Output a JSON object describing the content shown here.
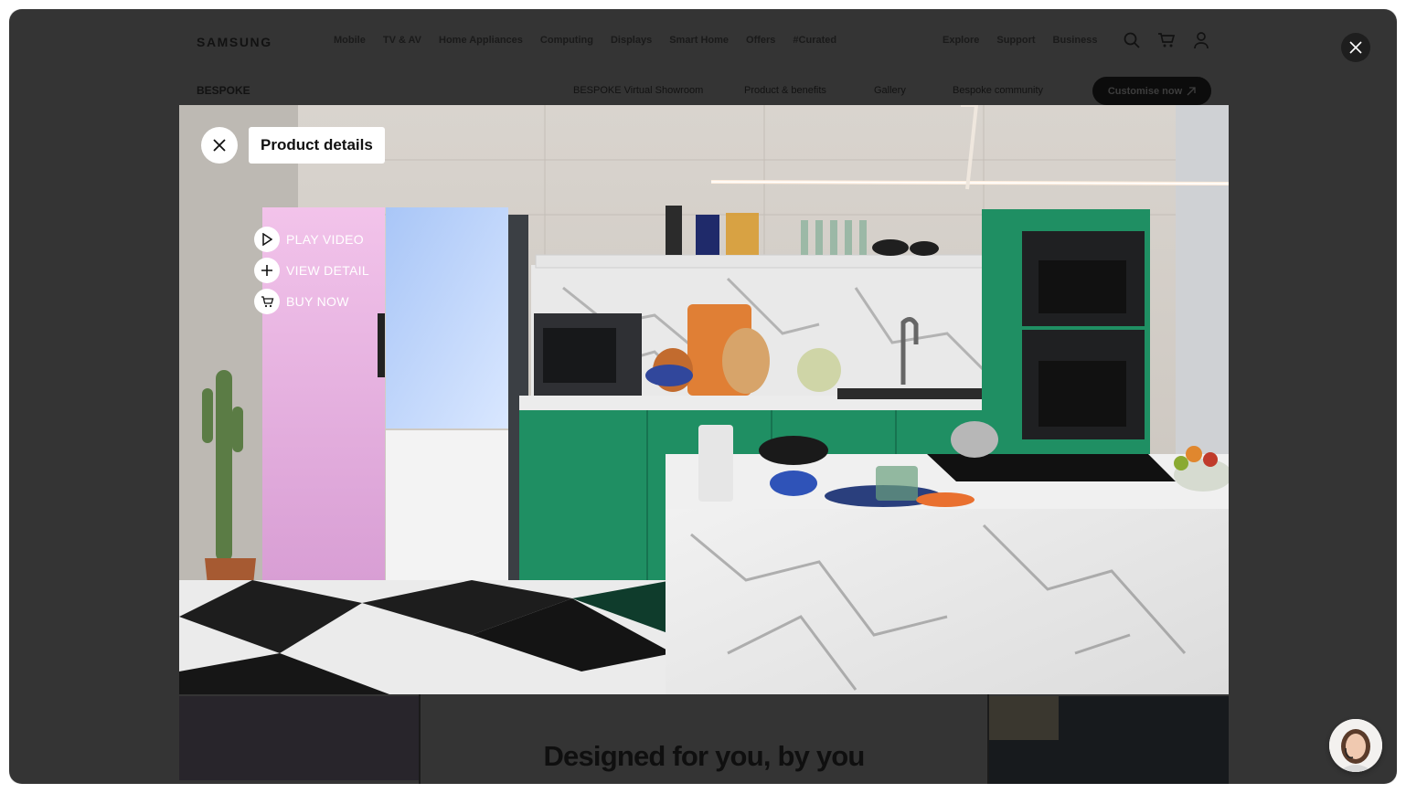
{
  "header": {
    "logo": "SAMSUNG",
    "nav": [
      "Mobile",
      "TV & AV",
      "Home Appliances",
      "Computing",
      "Displays",
      "Smart Home",
      "Offers",
      "#Curated"
    ],
    "util": [
      "Explore",
      "Support",
      "Business"
    ],
    "icons": [
      "search-icon",
      "cart-icon",
      "user-icon"
    ]
  },
  "subnav": {
    "brand": "BESPOKE",
    "links": [
      "BESPOKE Virtual Showroom",
      "Product & benefits",
      "Gallery",
      "Bespoke community"
    ],
    "cta": "Customise now"
  },
  "viewer": {
    "title": "Product details",
    "hotspots": [
      {
        "label": "PLAY VIDEO",
        "icon": "play-icon"
      },
      {
        "label": "VIEW DETAIL",
        "icon": "plus-icon"
      },
      {
        "label": "BUY NOW",
        "icon": "cart-icon"
      }
    ]
  },
  "section": {
    "headline": "Designed for you, by you"
  },
  "colors": {
    "overlay": "#343434",
    "cabinet_green": "#1f8f63",
    "fridge_pink": "#e9b3e3",
    "fridge_blue": "#bcd4fb",
    "fridge_white": "#f3f3f3"
  }
}
